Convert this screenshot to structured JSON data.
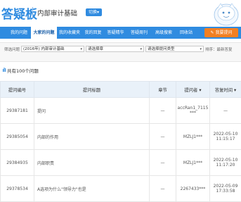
{
  "header": {
    "logo_text": "答疑板",
    "course_name": "内部审计基础",
    "switch_label": "切换▾"
  },
  "nav": {
    "items": [
      {
        "label": "我的问题",
        "active": false
      },
      {
        "label": "大家的问题",
        "active": true
      },
      {
        "label": "我的收藏夹",
        "active": false
      },
      {
        "label": "我的回复",
        "active": false
      },
      {
        "label": "答疑精华",
        "active": false
      },
      {
        "label": "答疑周刊",
        "active": false
      },
      {
        "label": "高级搜索",
        "active": false
      },
      {
        "label": "回收站",
        "active": false
      }
    ],
    "ask_label": "我要提问"
  },
  "filter": {
    "label": "筛选问题",
    "course_select": "(2016年) 内部审计基础",
    "chapter_select": "请选择章",
    "type_select": "请选择提问类型",
    "sort_label": "排序：",
    "sort_value": "最新答复"
  },
  "summary": {
    "total_text": "共有100个问题"
  },
  "table": {
    "headers": [
      "提问编号",
      "提问标题",
      "章节",
      "提问者",
      "答复时间"
    ],
    "rows": [
      {
        "id": "29387181",
        "title": "提问",
        "chapter": "—",
        "asker": "accRan1_7115***",
        "time": "—"
      },
      {
        "id": "29385054",
        "title": "内部的作用",
        "chapter": "—",
        "asker": "MZLJ1***",
        "time": "2022-05-10 11:15:17"
      },
      {
        "id": "29384935",
        "title": "内部职责",
        "chapter": "—",
        "asker": "MZLJ1***",
        "time": "2022-05-10 11:17:20"
      },
      {
        "id": "29378534",
        "title": "A选项为什么\"领导力\"也是",
        "chapter": "—",
        "asker": "2267433***",
        "time": "2022-05-09 17:33:58"
      }
    ]
  }
}
